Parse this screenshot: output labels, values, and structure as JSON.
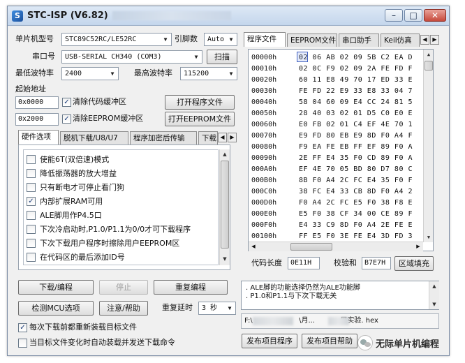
{
  "window": {
    "title": "STC-ISP (V6.82)",
    "icon_letter": "S"
  },
  "titlebar_buttons": {
    "minimize": "–",
    "maximize": "□",
    "close": "✕"
  },
  "left": {
    "mcu_label": "单片机型号",
    "mcu_value": "STC89C52RC/LE52RC",
    "pin_label": "引脚数",
    "pin_value": "Auto",
    "port_label": "串口号",
    "port_value": "USB-SERIAL CH340 (COM3)",
    "scan_button": "扫描",
    "min_baud_label": "最低波特率",
    "min_baud_value": "2400",
    "max_baud_label": "最高波特率",
    "max_baud_value": "115200",
    "start_addr_label": "起始地址",
    "addr1_value": "0x0000",
    "clear_code_label": "清除代码缓冲区",
    "clear_code_checked": true,
    "open_program_button": "打开程序文件",
    "addr2_value": "0x2000",
    "clear_eeprom_label": "清除EEPROM缓冲区",
    "clear_eeprom_checked": true,
    "open_eeprom_button": "打开EEPROM文件"
  },
  "left_tabs": [
    {
      "label": "硬件选项",
      "active": true
    },
    {
      "label": "脱机下载/U8/U7",
      "active": false
    },
    {
      "label": "程序加密后传输",
      "active": false
    },
    {
      "label": "下载",
      "active": false
    }
  ],
  "hardware_options": [
    {
      "label": "使能6T(双倍速)模式",
      "checked": false
    },
    {
      "label": "降低振荡器的放大增益",
      "checked": false
    },
    {
      "label": "只有断电才可停止看门狗",
      "checked": false
    },
    {
      "label": "内部扩展RAM可用",
      "checked": true
    },
    {
      "label": "ALE脚用作P4.5口",
      "checked": false
    },
    {
      "label": "下次冷启动时,P1.0/P1.1为0/0才可下载程序",
      "checked": false
    },
    {
      "label": "下次下载用户程序时擦除用户EEPROM区",
      "checked": false
    },
    {
      "label": "在代码区的最后添加ID号",
      "checked": false
    }
  ],
  "actions": {
    "download": "下载/编程",
    "stop": "停止",
    "reprogram": "重复编程",
    "check_mcu": "检测MCU选项",
    "help": "注意/帮助",
    "repeat_delay_label": "重复延时",
    "repeat_delay_value": "3 秒"
  },
  "bottom_checks": [
    {
      "label": "每次下载前都重新装载目标文件",
      "checked": true
    },
    {
      "label": "当目标文件变化时自动装载并发送下载命令",
      "checked": false
    }
  ],
  "right_tabs": [
    {
      "label": "程序文件",
      "active": true
    },
    {
      "label": "EEPROM文件",
      "active": false
    },
    {
      "label": "串口助手",
      "active": false
    },
    {
      "label": "Keil仿真",
      "active": false
    }
  ],
  "hex_rows": [
    {
      "addr": "00000h",
      "bytes": "02 06 AB 02 09 5B C2 EA D"
    },
    {
      "addr": "00010h",
      "bytes": "02 0C F9 02 09 2A FE FD F"
    },
    {
      "addr": "00020h",
      "bytes": "60 11 E8 49 70 17 ED 33 E"
    },
    {
      "addr": "00030h",
      "bytes": "FE FD 22 E9 33 E8 33 04 7"
    },
    {
      "addr": "00040h",
      "bytes": "58 04 60 09 E4 CC 24 81 5"
    },
    {
      "addr": "00050h",
      "bytes": "28 40 03 02 01 D5 C0 E0 E"
    },
    {
      "addr": "00060h",
      "bytes": "E0 FB 02 01 C4 EF 4E 70 1"
    },
    {
      "addr": "00070h",
      "bytes": "E9 FD 80 EB E9 8D F0 A4 F"
    },
    {
      "addr": "00080h",
      "bytes": "F9 EA FE EB FF EF 89 F0 A"
    },
    {
      "addr": "00090h",
      "bytes": "2E FF E4 35 F0 CD 89 F0 A"
    },
    {
      "addr": "000A0h",
      "bytes": "EF 4E 70 05 BD 80 D7 80 C"
    },
    {
      "addr": "000B0h",
      "bytes": "8B F0 A4 2C FC E4 35 F0 F"
    },
    {
      "addr": "000C0h",
      "bytes": "38 FC E4 33 CB 8D F0 A4 2"
    },
    {
      "addr": "000D0h",
      "bytes": "F0 A4 2C FC E5 F0 38 F8 E"
    },
    {
      "addr": "000E0h",
      "bytes": "E5 F0 38 CF 34 00 CE 89 F"
    },
    {
      "addr": "000F0h",
      "bytes": "E4 33 C9 8D F0 A4 2E FE E"
    },
    {
      "addr": "00100h",
      "bytes": "FF E5 F0 3E FE E4 3D FD 3"
    }
  ],
  "code_info": {
    "length_label": "代码长度",
    "length_value": "0E11H",
    "checksum_label": "校验和",
    "checksum_value": "B7E7H",
    "fill_button": "区域填充"
  },
  "info_messages": [
    "ALE脚的功能选择仍然为ALE功能脚",
    "P1.0和P1.1与下次下载无关"
  ],
  "file_path": {
    "prefix": "F:\\",
    "mid": "\\月...",
    "suffix": "展实验. hex"
  },
  "bottom_buttons": {
    "publish_program": "发布项目程序",
    "publish_help": "发布项目帮助"
  },
  "watermark": "无际单片机编程"
}
